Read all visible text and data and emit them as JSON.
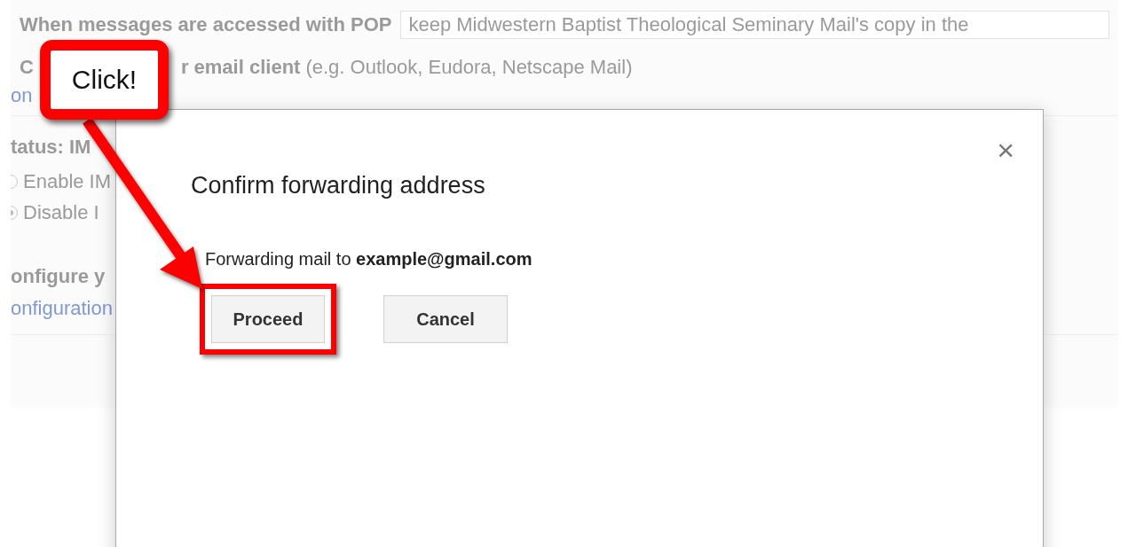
{
  "background": {
    "pop_label": "When messages are accessed with POP",
    "pop_field_value": "keep Midwestern Baptist Theological Seminary Mail's copy in the",
    "client_row": {
      "lead": "C",
      "label": "r email client",
      "hint": "(e.g. Outlook, Eudora, Netscape Mail)"
    },
    "client_link": "on",
    "imap_status": "tatus: IM",
    "imap_options": [
      {
        "label": "Enable IM",
        "selected": false
      },
      {
        "label": "Disable I",
        "selected": true
      }
    ],
    "configure_label": "onfigure y",
    "configure_link": "onfiguration"
  },
  "dialog": {
    "title": "Confirm forwarding address",
    "close": "×",
    "message": "Forwarding mail to **example@gmail.com**",
    "buttons": [
      {
        "label": "Proceed",
        "highlighted": true
      },
      {
        "label": "Cancel",
        "highlighted": false
      }
    ]
  },
  "callout": {
    "text": "Click!"
  }
}
